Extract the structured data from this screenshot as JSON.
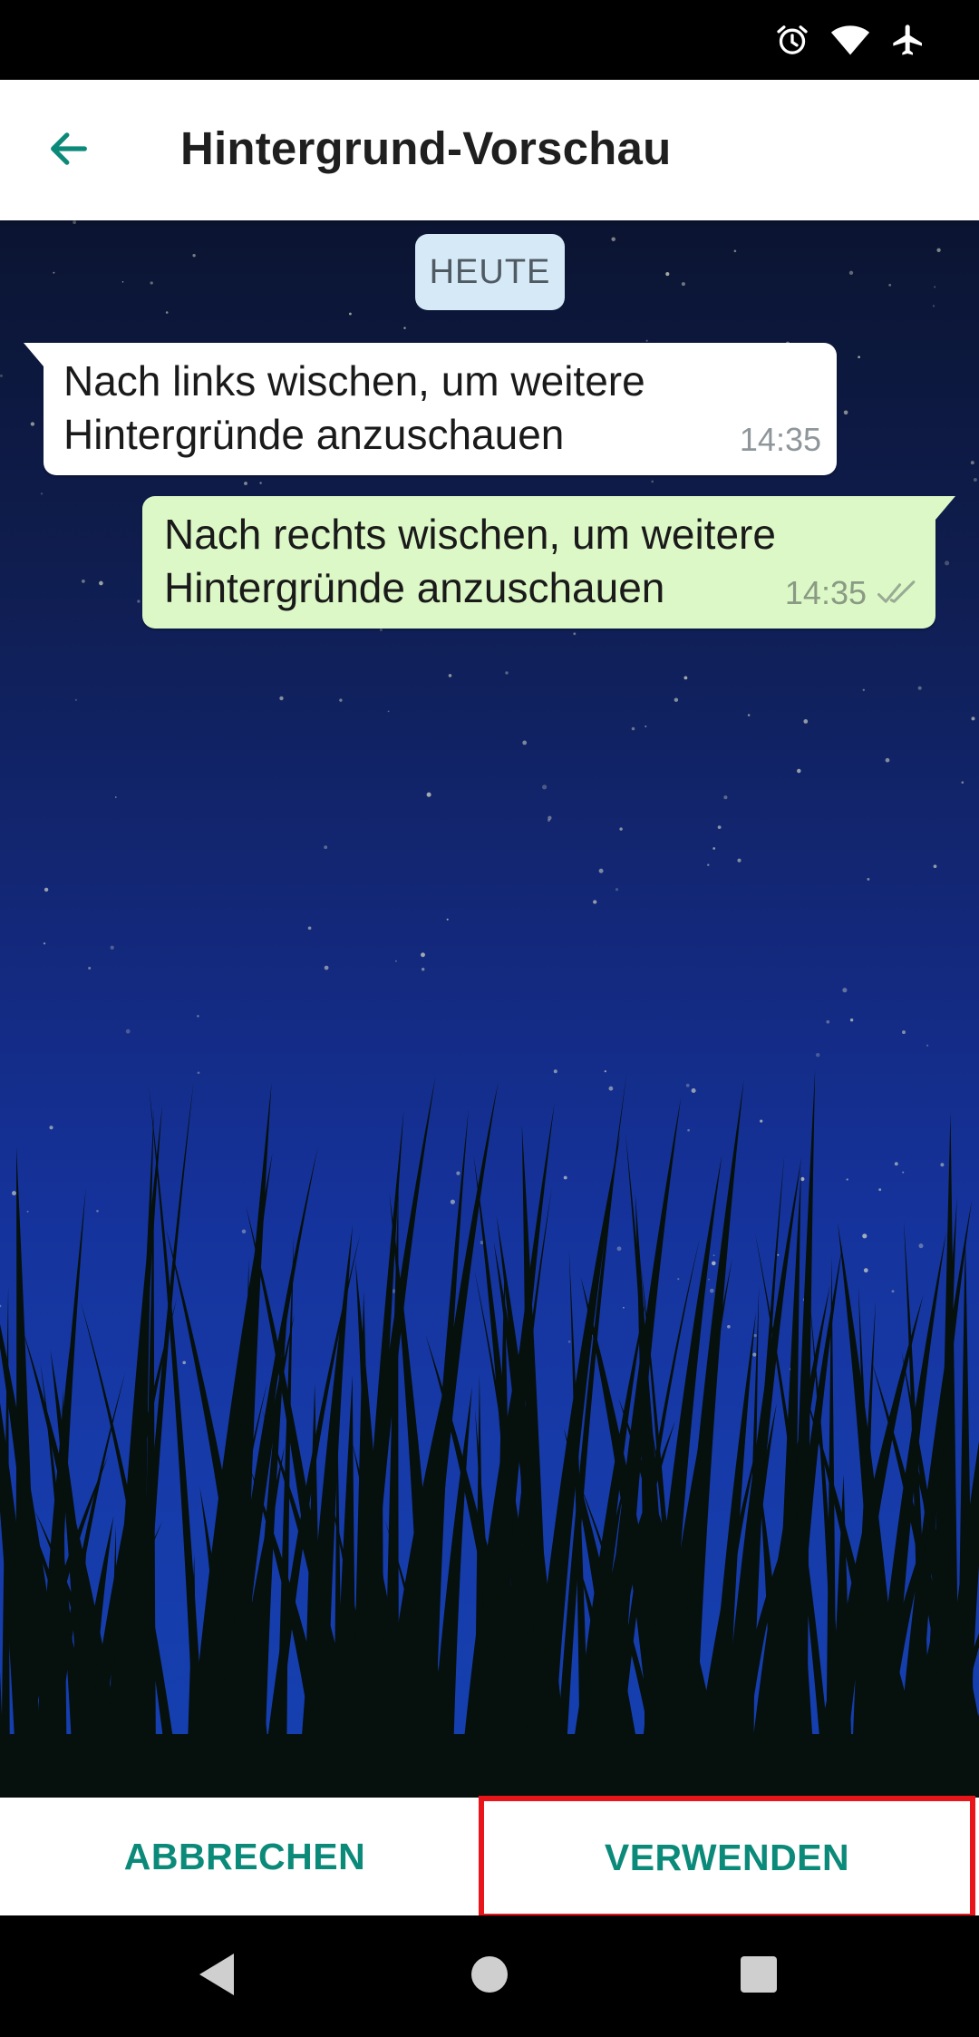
{
  "status_bar": {
    "icons": [
      "alarm-icon",
      "wifi-icon",
      "airplane-mode-icon"
    ]
  },
  "app_bar": {
    "title": "Hintergrund-Vorschau",
    "back_icon": "arrow-back-icon",
    "accent_color": "#0b8a7a"
  },
  "chat": {
    "date_chip": "HEUTE",
    "messages": [
      {
        "direction": "incoming",
        "text": "Nach links wischen, um weitere\nHintergründe anzuschauen",
        "time": "14:35"
      },
      {
        "direction": "outgoing",
        "text": "Nach rechts wischen, um weitere\nHintergründe anzuschauen",
        "time": "14:35",
        "status_icon": "double-check-icon"
      }
    ]
  },
  "actions": {
    "cancel_label": "ABBRECHEN",
    "use_label": "VERWENDEN",
    "highlight_color": "#e8151b"
  },
  "nav_bar": {
    "icons": [
      "nav-back-icon",
      "nav-home-icon",
      "nav-recents-icon"
    ]
  }
}
